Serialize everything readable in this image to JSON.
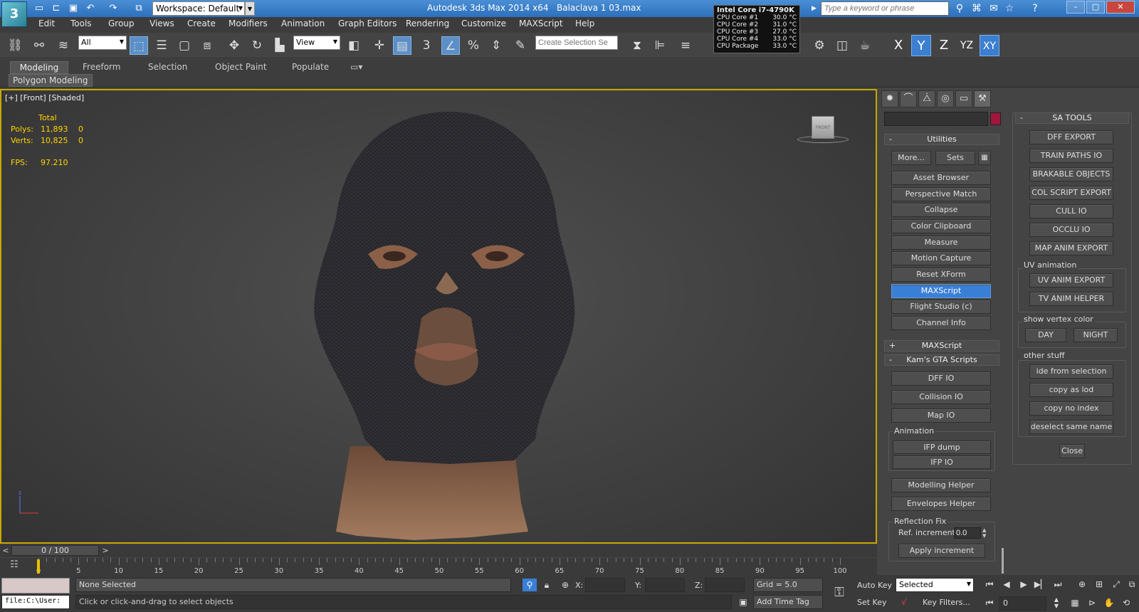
{
  "titlebar": {
    "app_title": "Autodesk 3ds Max  2014 x64",
    "file_name": "Balaclava 1 03.max",
    "workspace": "Workspace: Default",
    "search_placeholder": "Type a keyword or phrase"
  },
  "cpu_monitor": {
    "header": "Intel Core i7-4790K",
    "rows": [
      {
        "name": "CPU Core #1",
        "temp": "30.0 °C"
      },
      {
        "name": "CPU Core #2",
        "temp": "31.0 °C"
      },
      {
        "name": "CPU Core #3",
        "temp": "27.0 °C"
      },
      {
        "name": "CPU Core #4",
        "temp": "33.0 °C"
      },
      {
        "name": "CPU Package",
        "temp": "33.0 °C"
      }
    ]
  },
  "menubar": [
    "Edit",
    "Tools",
    "Group",
    "Views",
    "Create",
    "Modifiers",
    "Animation",
    "Graph Editors",
    "Rendering",
    "Customize",
    "MAXScript",
    "Help"
  ],
  "toolbar": {
    "selection_filter": "All",
    "reference_coord": "View",
    "snap_value": "3",
    "named_selection_placeholder": "Create Selection Se",
    "axes": [
      "X",
      "Y",
      "Z",
      "YZ",
      "XY"
    ]
  },
  "ribbon": {
    "tabs": [
      "Modeling",
      "Freeform",
      "Selection",
      "Object Paint",
      "Populate"
    ],
    "panel": "Polygon Modeling"
  },
  "viewport": {
    "label": "[+] [Front] [Shaded]",
    "stats": {
      "total_label": "Total",
      "polys_label": "Polys:",
      "polys_total": "11,893",
      "polys_sel": "0",
      "verts_label": "Verts:",
      "verts_total": "10,825",
      "verts_sel": "0",
      "fps_label": "FPS:",
      "fps": "97.210"
    },
    "viewcube_face": "FRONT",
    "axis_label": "z"
  },
  "utilities": {
    "header": "Utilities",
    "more": "More...",
    "sets": "Sets",
    "buttons": [
      "Asset Browser",
      "Perspective Match",
      "Collapse",
      "Color Clipboard",
      "Measure",
      "Motion Capture",
      "Reset XForm",
      "MAXScript",
      "Flight Studio (c)",
      "Channel Info"
    ],
    "selected": "MAXScript",
    "maxscript_rollout": "MAXScript",
    "kam_rollout": "Kam's GTA Scripts",
    "kam_buttons": [
      "DFF IO",
      "Collision IO",
      "Map IO"
    ],
    "animation_label": "Animation",
    "animation_buttons": [
      "IFP dump",
      "IFP IO"
    ],
    "helper_buttons": [
      "Modelling Helper",
      "Envelopes Helper"
    ],
    "reflection_label": "Reflection Fix",
    "ref_increment_label": "Ref. increment",
    "ref_increment_value": "0.0",
    "apply_increment": "Apply increment"
  },
  "sa_tools": {
    "header": "SA TOOLS",
    "buttons": [
      "DFF EXPORT",
      "TRAIN PATHS IO",
      "BRAKABLE OBJECTS",
      "COL SCRIPT EXPORT",
      "CULL IO",
      "OCCLU IO",
      "MAP ANIM EXPORT"
    ],
    "uv_label": "UV animation",
    "uv_buttons": [
      "UV ANIM EXPORT",
      "TV ANIM HELPER"
    ],
    "vc_label": "show vertex color",
    "vc_buttons": [
      "DAY",
      "NIGHT"
    ],
    "other_label": "other stuff",
    "other_buttons": [
      "ide from selection",
      "copy as lod",
      "copy no index",
      "deselect same name"
    ],
    "close": "Close"
  },
  "timeline": {
    "frame": "0 / 100",
    "prev": "<",
    "next": ">",
    "ticks": [
      "0",
      "5",
      "10",
      "15",
      "20",
      "25",
      "30",
      "35",
      "40",
      "45",
      "50",
      "55",
      "60",
      "65",
      "70",
      "75",
      "80",
      "85",
      "90",
      "95",
      "100"
    ]
  },
  "status": {
    "script_line": "file:C:\\User:",
    "selection": "None Selected",
    "prompt": "Click or click-and-drag to select objects",
    "x_label": "X:",
    "y_label": "Y:",
    "z_label": "Z:",
    "grid": "Grid = 5.0",
    "add_time_tag": "Add Time Tag",
    "auto_key": "Auto Key",
    "set_key": "Set Key",
    "key_mode": "Selected",
    "key_filters": "Key Filters...",
    "frame_field": "0"
  }
}
